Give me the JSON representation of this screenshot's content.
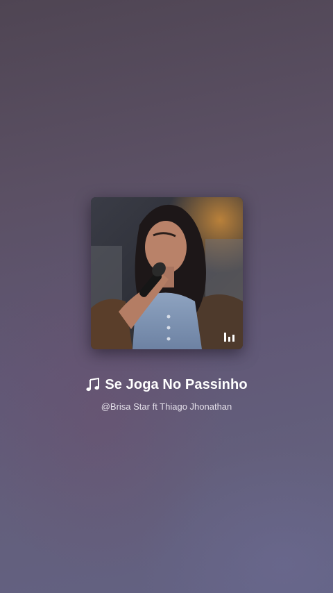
{
  "track": {
    "title": "Se Joga No Passinho",
    "artist": "@Brisa Star ft Thiago Jhonathan"
  },
  "icons": {
    "title_icon": "music-note-icon",
    "cover_badge": "equalizer-icon"
  },
  "colors": {
    "background_top": "#4f4553",
    "background_bottom": "#636283",
    "title_text": "#ffffff",
    "subtitle_text": "#e4e0ea"
  }
}
